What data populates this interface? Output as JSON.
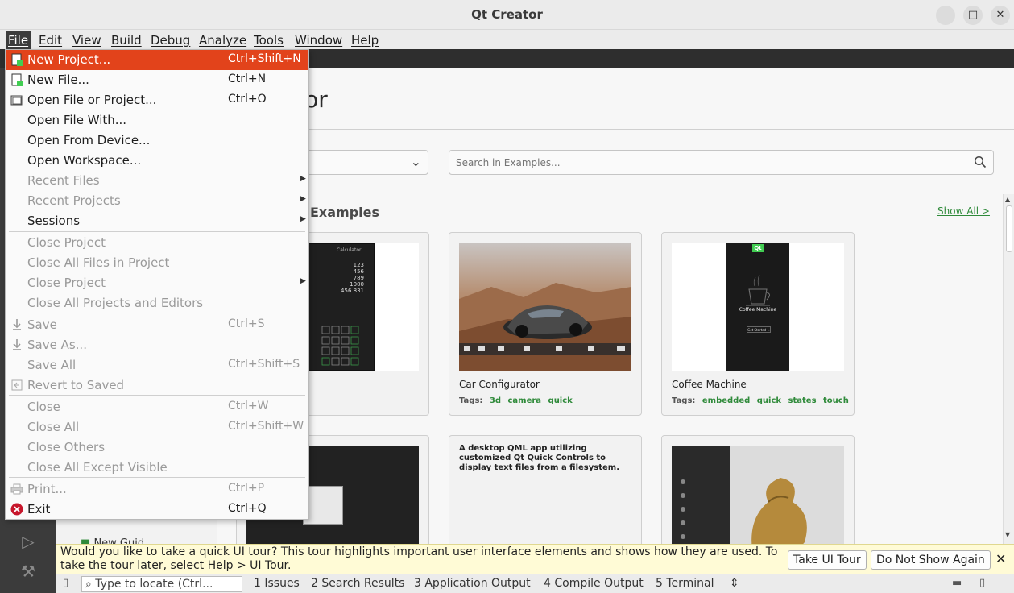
{
  "window": {
    "title": "Qt Creator"
  },
  "menubar": [
    "File",
    "Edit",
    "View",
    "Build",
    "Debug",
    "Analyze",
    "Tools",
    "Window",
    "Help"
  ],
  "file_menu": {
    "new_project": {
      "label": "New Project...",
      "shortcut": "Ctrl+Shift+N"
    },
    "new_file": {
      "label": "New File...",
      "shortcut": "Ctrl+N"
    },
    "open_file_or_project": {
      "label": "Open File or Project...",
      "shortcut": "Ctrl+O"
    },
    "open_file_with": {
      "label": "Open File With..."
    },
    "open_from_device": {
      "label": "Open From Device..."
    },
    "open_workspace": {
      "label": "Open Workspace..."
    },
    "recent_files": {
      "label": "Recent Files"
    },
    "recent_projects": {
      "label": "Recent Projects"
    },
    "sessions": {
      "label": "Sessions"
    },
    "close_project_1": {
      "label": "Close Project"
    },
    "close_all_files_in_project": {
      "label": "Close All Files in Project"
    },
    "close_project_2": {
      "label": "Close Project"
    },
    "close_all_projects_and_editors": {
      "label": "Close All Projects and Editors"
    },
    "save": {
      "label": "Save",
      "shortcut": "Ctrl+S"
    },
    "save_as": {
      "label": "Save As..."
    },
    "save_all": {
      "label": "Save All",
      "shortcut": "Ctrl+Shift+S"
    },
    "revert_to_saved": {
      "label": "Revert to Saved"
    },
    "close": {
      "label": "Close",
      "shortcut": "Ctrl+W"
    },
    "close_all": {
      "label": "Close All",
      "shortcut": "Ctrl+Shift+W"
    },
    "close_others": {
      "label": "Close Others"
    },
    "close_all_except_visible": {
      "label": "Close All Except Visible"
    },
    "print": {
      "label": "Print...",
      "shortcut": "Ctrl+P"
    },
    "exit": {
      "label": "Exit",
      "shortcut": "Ctrl+Q"
    }
  },
  "welcome": {
    "heading_visible": "ator",
    "search_placeholder": "Search in Examples...",
    "section_title_visible": "Examples",
    "show_all": "Show All >",
    "side_item_visible": "New Guid..."
  },
  "examples": [
    {
      "name": "Car Configurator",
      "tags_label": "Tags:",
      "tags": [
        "3d",
        "camera",
        "quick"
      ]
    },
    {
      "name": "Coffee Machine",
      "tags_label": "Tags:",
      "tags": [
        "embedded",
        "quick",
        "states",
        "touch"
      ]
    },
    {
      "description": "A desktop QML app utilizing customized Qt Quick Controls to display text files from a filesystem."
    }
  ],
  "calculator_preview": {
    "title": "Calculator",
    "lines": [
      "123",
      "456",
      "789",
      "1000",
      "456.831"
    ]
  },
  "coffee_preview": {
    "badge": "Qt",
    "title": "Coffee Machine",
    "button": "Get Started →"
  },
  "tour": {
    "message": "Would you like to take a quick UI tour? This tour highlights important user interface elements and shows how they are used. To take the tour later, select Help > UI Tour.",
    "take_label": "Take UI Tour",
    "dont_show_label": "Do Not Show Again"
  },
  "statusbar": {
    "locate_placeholder": "Type to locate (Ctrl...",
    "tabs": [
      "1  Issues",
      "2  Search Results",
      "3  Application Output",
      "4  Compile Output",
      "5  Terminal"
    ]
  },
  "colors": {
    "menu_highlight": "#e2431b",
    "accent_green": "#2f8a3a",
    "tour_bg": "#fffbd6"
  }
}
